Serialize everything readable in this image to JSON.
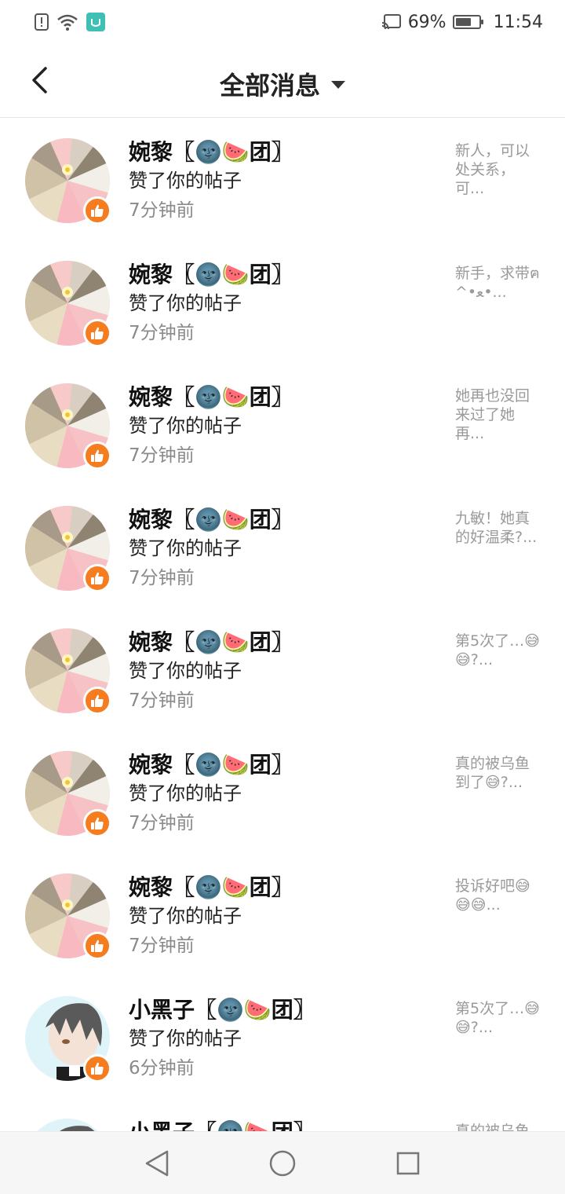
{
  "status_bar": {
    "battery": "69%",
    "battery_level": 0.69,
    "time": "11:54"
  },
  "header": {
    "title": "全部消息"
  },
  "notifications": [
    {
      "name": "婉黎〖🌚🍉团〗",
      "action": "赞了你的帖子",
      "time": "7分钟前",
      "preview": "新人，可以处关系，可...",
      "avatar": "pink-fan"
    },
    {
      "name": "婉黎〖🌚🍉团〗",
      "action": "赞了你的帖子",
      "time": "7分钟前",
      "preview": "新手，求带ฅ^•ﻌ•...",
      "avatar": "pink-fan"
    },
    {
      "name": "婉黎〖🌚🍉团〗",
      "action": "赞了你的帖子",
      "time": "7分钟前",
      "preview": "她再也没回来过了她再...",
      "avatar": "pink-fan"
    },
    {
      "name": "婉黎〖🌚🍉团〗",
      "action": "赞了你的帖子",
      "time": "7分钟前",
      "preview": "九敏！她真的好温柔?...",
      "avatar": "pink-fan"
    },
    {
      "name": "婉黎〖🌚🍉团〗",
      "action": "赞了你的帖子",
      "time": "7分钟前",
      "preview": "第5次了…😅😅?...",
      "avatar": "pink-fan"
    },
    {
      "name": "婉黎〖🌚🍉团〗",
      "action": "赞了你的帖子",
      "time": "7分钟前",
      "preview": "真的被乌鱼到了😅?...",
      "avatar": "pink-fan"
    },
    {
      "name": "婉黎〖🌚🍉团〗",
      "action": "赞了你的帖子",
      "time": "7分钟前",
      "preview": "投诉好吧😅😅😅...",
      "avatar": "pink-fan"
    },
    {
      "name": "小黑子〖🌚🍉团〗",
      "action": "赞了你的帖子",
      "time": "6分钟前",
      "preview": "第5次了…😅😅?...",
      "avatar": "anime-boy"
    },
    {
      "name": "小黑子〖🌚🍉团〗",
      "action": "",
      "time": "",
      "preview": "真的被乌鱼",
      "avatar": "anime-boy"
    }
  ],
  "colors": {
    "like_badge": "#f57c1f",
    "time_text": "#8a8a8a",
    "preview_text": "#9a9a9a"
  }
}
